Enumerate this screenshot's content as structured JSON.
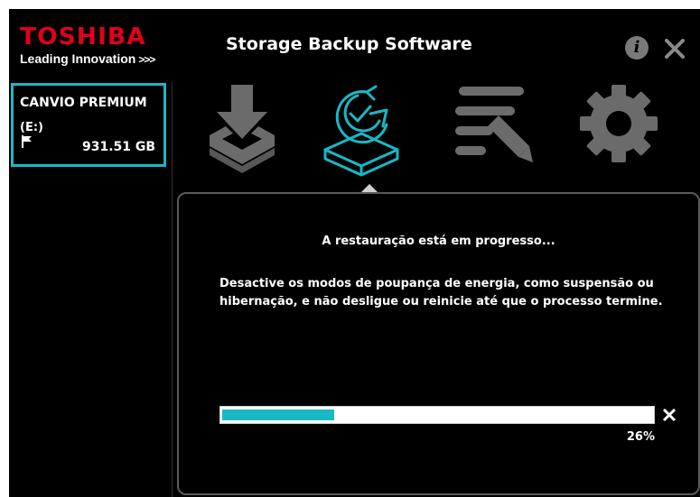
{
  "header": {
    "brand": "TOSHIBA",
    "tagline": "Leading Innovation",
    "tagline_chevrons": ">>>",
    "app_title": "Storage Backup Software",
    "info_label": "i"
  },
  "sidebar": {
    "drive": {
      "name": "CANVIO PREMIUM",
      "letter": "(E:)",
      "size": "931.51 GB"
    }
  },
  "toolbar": {
    "items": [
      {
        "name": "backup",
        "icon": "download-to-tray-icon",
        "state": "inactive"
      },
      {
        "name": "restore",
        "icon": "restore-refresh-icon",
        "state": "active"
      },
      {
        "name": "edit",
        "icon": "list-edit-icon",
        "state": "inactive"
      },
      {
        "name": "settings",
        "icon": "gear-icon",
        "state": "inactive"
      }
    ]
  },
  "panel": {
    "heading": "A restauração está em progresso...",
    "message": "Desactive os modos de poupança de energia, como suspensão ou hibernação, e não desligue ou reinicie até que o processo termine.",
    "progress_percent": 26,
    "progress_label": "26%"
  },
  "colors": {
    "brand_red": "#e0001b",
    "accent_cyan": "#19b8c6",
    "inactive_icon": "#6b6b6b",
    "background": "#000000"
  }
}
